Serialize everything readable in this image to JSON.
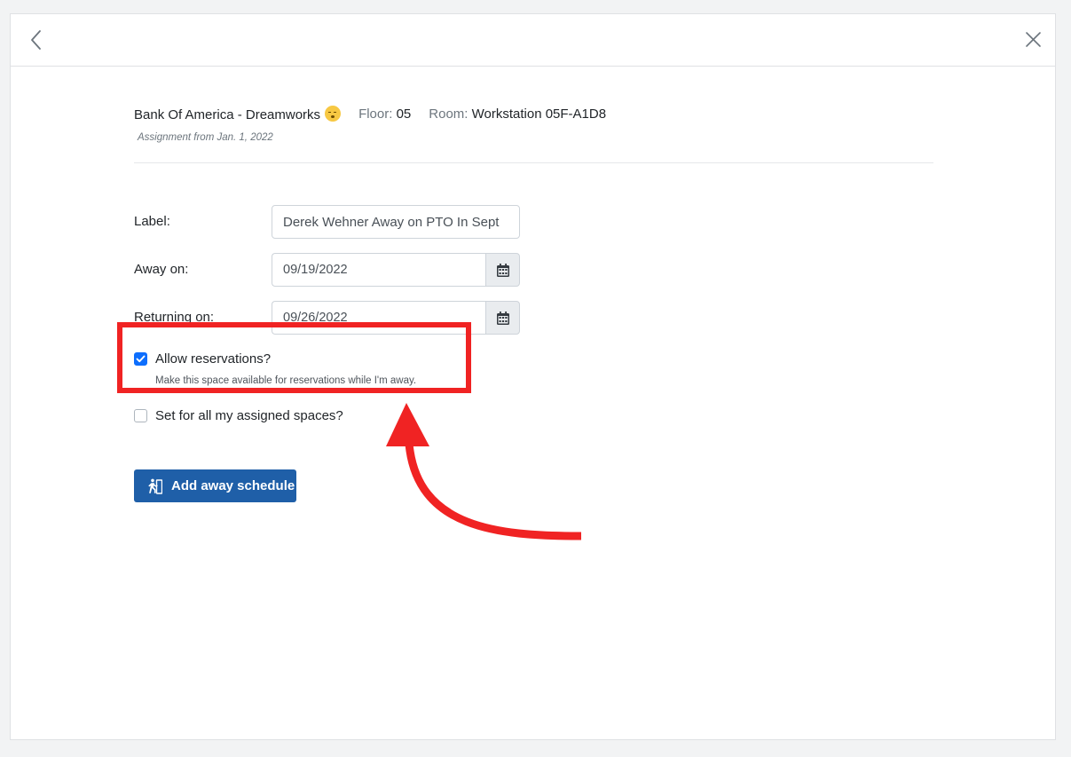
{
  "location": {
    "site": "Bank Of America - Dreamworks",
    "site_emoji": "sleeping-face",
    "floor_label": "Floor:",
    "floor_value": "05",
    "room_label": "Room:",
    "room_value": "Workstation 05F-A1D8"
  },
  "assignment_text": "Assignment from Jan. 1, 2022",
  "form": {
    "label_title": "Label:",
    "label_value": "Derek Wehner Away on PTO In Sept",
    "away_title": "Away on:",
    "away_value": "09/19/2022",
    "returning_title": "Returning on:",
    "returning_value": "09/26/2022",
    "allow_reservations_label": "Allow reservations?",
    "allow_reservations_checked": true,
    "allow_reservations_help": "Make this space available for reservations while I'm away.",
    "set_all_label": "Set for all my assigned spaces?",
    "set_all_checked": false,
    "submit_label": "Add away schedule"
  },
  "icons": {
    "back": "chevron-left-icon",
    "close": "close-icon",
    "calendar": "calendar-icon",
    "submit": "running-person-icon"
  },
  "colors": {
    "primary": "#1f5fa8",
    "checkbox": "#0d6efd",
    "annotation": "#f02323"
  }
}
